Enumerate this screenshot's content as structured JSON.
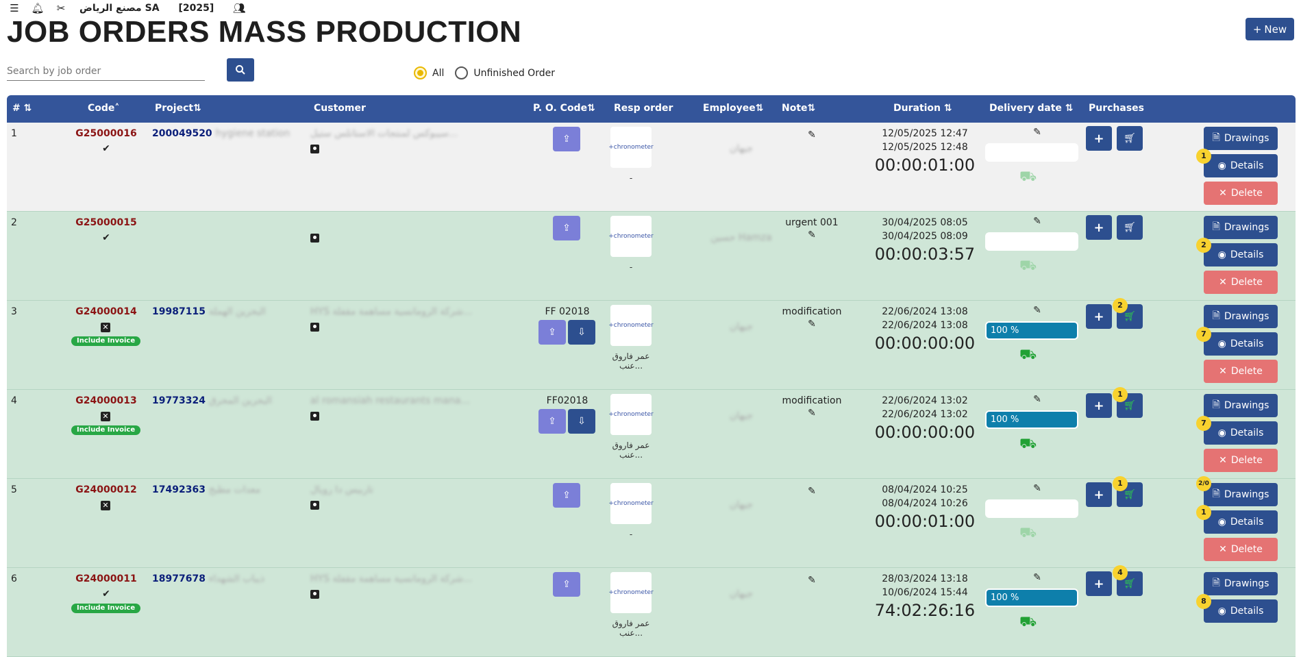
{
  "topbar": {
    "company": "مصنع الرياض SA",
    "year": "[2025]"
  },
  "page": {
    "title": "JOB ORDERS MASS PRODUCTION",
    "new_label": "New"
  },
  "search": {
    "placeholder": "Search by job order"
  },
  "filters": {
    "all": "All",
    "unfinished": "Unfinished Order"
  },
  "columns": [
    "#",
    "Code",
    "Project",
    "Customer",
    "P. O. Code",
    "Resp order",
    "Employee",
    "Note",
    "Duration",
    "Delivery date",
    "Purchases"
  ],
  "buttons": {
    "drawings": "Drawings",
    "details": "Details",
    "delete": "Delete",
    "include_invoice": "Include Invoice",
    "logo": "+chronometer"
  },
  "rows": [
    {
      "num": "1",
      "code": "G25000016",
      "project": "200049520",
      "project_name": "hygiene station",
      "customer": "سيبوكس لمنتجات الاستانلس ستيل...",
      "po": "",
      "resp_sub": "-",
      "employee": "جيهان",
      "note": "",
      "start": "12/05/2025  12:47",
      "end": "12/05/2025  12:48",
      "duration": "00:00:01:00",
      "progress": "",
      "purchase_badge": "",
      "detail_badge": "1",
      "draw_badge": ""
    },
    {
      "num": "2",
      "code": "G25000015",
      "project": "",
      "project_name": "",
      "customer": "",
      "po": "",
      "resp_sub": "-",
      "employee": "حسين Hamza",
      "note": "urgent 001",
      "start": "30/04/2025  08:05",
      "end": "30/04/2025  08:09",
      "duration": "00:00:03:57",
      "progress": "",
      "purchase_badge": "",
      "detail_badge": "2",
      "draw_badge": ""
    },
    {
      "num": "3",
      "code": "G24000014",
      "project": "19987115",
      "project_name": "البحرين الهملة",
      "customer": "HYS شركة الرومانسية مساهمة مقفلة...",
      "po": "FF 02018",
      "resp_sub": "عمر فاروق عنب...",
      "employee": "جيهان",
      "note": "modification",
      "start": "22/06/2024  13:08",
      "end": "22/06/2024  13:08",
      "duration": "00:00:00:00",
      "progress": "100 %",
      "purchase_badge": "2",
      "detail_badge": "7",
      "draw_badge": ""
    },
    {
      "num": "4",
      "code": "G24000013",
      "project": "19773324",
      "project_name": "البحرين المحرق",
      "customer": "al romansiah restaurants mana...",
      "po": "FF02018",
      "resp_sub": "عمر فاروق عنب...",
      "employee": "جيهان",
      "note": "modification",
      "start": "22/06/2024  13:02",
      "end": "22/06/2024  13:02",
      "duration": "00:00:00:00",
      "progress": "100 %",
      "purchase_badge": "1",
      "detail_badge": "7",
      "draw_badge": ""
    },
    {
      "num": "5",
      "code": "G24000012",
      "project": "17492363",
      "project_name": "معدات مطبخ",
      "customer": "تاربيس دا رويال",
      "po": "",
      "resp_sub": "-",
      "employee": "جيهان",
      "note": "",
      "start": "08/04/2024  10:25",
      "end": "08/04/2024  10:26",
      "duration": "00:00:01:00",
      "progress": "",
      "purchase_badge": "1",
      "detail_badge": "1",
      "draw_badge": "2/0"
    },
    {
      "num": "6",
      "code": "G24000011",
      "project": "18977678",
      "project_name": "ذيباب الشهداء",
      "customer": "HYS شركة الرومانسية مساهمة مقفلة...",
      "po": "",
      "resp_sub": "عمر فاروق عنب...",
      "employee": "جيهان",
      "note": "",
      "start": "28/03/2024  13:18",
      "end": "10/06/2024 15:44",
      "duration": "74:02:26:16",
      "progress": "100 %",
      "purchase_badge": "4",
      "detail_badge": "8",
      "draw_badge": ""
    }
  ]
}
